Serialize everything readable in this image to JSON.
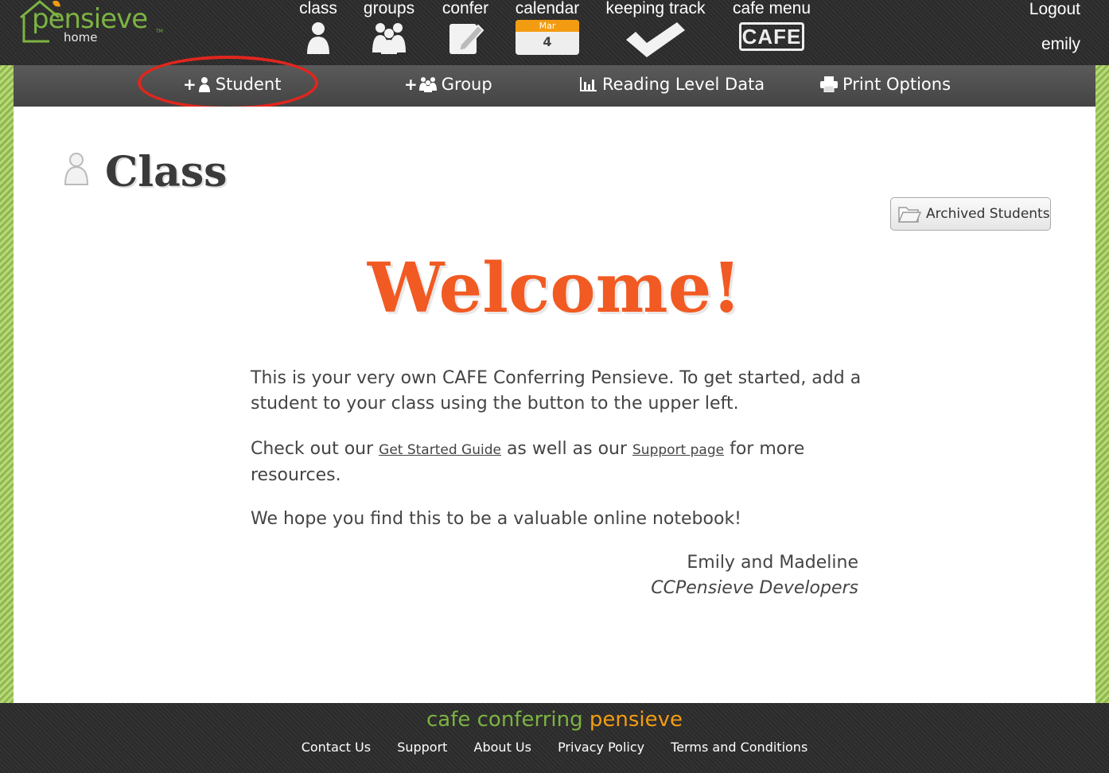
{
  "header": {
    "logo_text": "pensieve",
    "logo_sub": "home",
    "logo_tm": "TM",
    "nav": [
      {
        "label": "class",
        "icon": "person-icon"
      },
      {
        "label": "groups",
        "icon": "group-icon"
      },
      {
        "label": "confer",
        "icon": "notepad-pencil-icon"
      },
      {
        "label": "calendar",
        "icon": "calendar-icon",
        "month": "Mar",
        "day": "4"
      },
      {
        "label": "keeping track",
        "icon": "checkmark-icon"
      },
      {
        "label": "cafe menu",
        "icon": "cafe-icon",
        "badge": "CAFE"
      }
    ],
    "logout": "Logout",
    "user": "emily"
  },
  "subnav": {
    "items": [
      {
        "label": "Student",
        "prefix": "+",
        "icon": "person-icon"
      },
      {
        "label": "Group",
        "prefix": "+",
        "icon": "group-icon"
      },
      {
        "label": "Reading Level Data",
        "icon": "bar-chart-icon"
      },
      {
        "label": "Print Options",
        "icon": "printer-icon"
      }
    ]
  },
  "main": {
    "title": "Class",
    "archived_button": "Archived Students",
    "welcome": "Welcome!",
    "paragraph1": "This is your very own CAFE Conferring Pensieve. To get started, add a student to your class using the button to the upper left.",
    "paragraph2_a": "Check out our ",
    "paragraph2_link1": "Get Started Guide",
    "paragraph2_b": " as well as our ",
    "paragraph2_link2": "Support page",
    "paragraph2_c": " for more resources.",
    "paragraph3": "We hope you find this to be a valuable online notebook!",
    "signature_names": "Emily and Madeline",
    "signature_title": "CCPensieve Developers"
  },
  "footer": {
    "brand_a": "cafe conferring ",
    "brand_b": "pensieve",
    "links": [
      "Contact Us",
      "Support",
      "About Us",
      "Privacy Policy",
      "Terms and Conditions"
    ]
  },
  "colors": {
    "accent_orange": "#f15a22",
    "brand_green": "#7cb342",
    "highlight_red": "#e0261e"
  }
}
